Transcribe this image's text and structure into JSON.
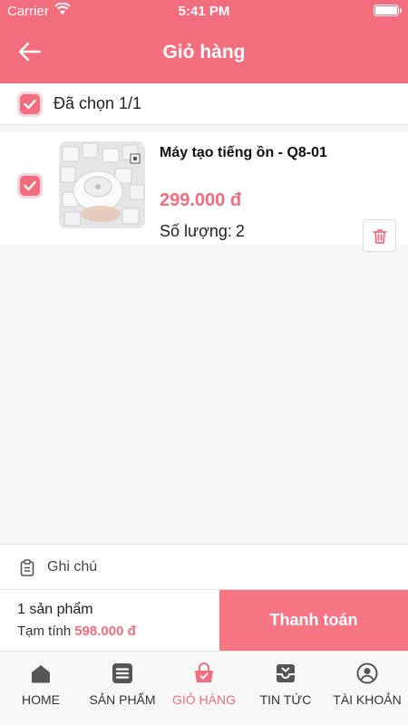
{
  "status_bar": {
    "carrier": "Carrier",
    "time": "5:41 PM"
  },
  "header": {
    "title": "Giỏ hàng",
    "back_icon": "arrow-left-icon"
  },
  "select_all": {
    "label": "Đã chọn 1/1",
    "checked": true
  },
  "cart_items": [
    {
      "name": "Máy tạo tiếng ồn - Q8-01",
      "price": "299.000 đ",
      "quantity_label": "Số lượng:",
      "quantity": "2",
      "checked": true
    }
  ],
  "note": {
    "label": "Ghi chú",
    "icon": "clipboard-icon"
  },
  "summary": {
    "count": "1 sản phẩm",
    "subtotal_label": "Tạm tính",
    "subtotal_value": "598.000 đ",
    "checkout_label": "Thanh toán"
  },
  "tabs": [
    {
      "label": "HOME",
      "icon": "home-icon",
      "active": false
    },
    {
      "label": "SẢN PHẨM",
      "icon": "list-icon",
      "active": false
    },
    {
      "label": "GIỎ HÀNG",
      "icon": "basket-icon",
      "active": true
    },
    {
      "label": "TIN TỨC",
      "icon": "inbox-icon",
      "active": false
    },
    {
      "label": "TÀI KHOẢN",
      "icon": "user-icon",
      "active": false
    }
  ],
  "colors": {
    "accent": "#f26d7d",
    "checkout": "#f57583",
    "background": "#f7f7f7"
  }
}
